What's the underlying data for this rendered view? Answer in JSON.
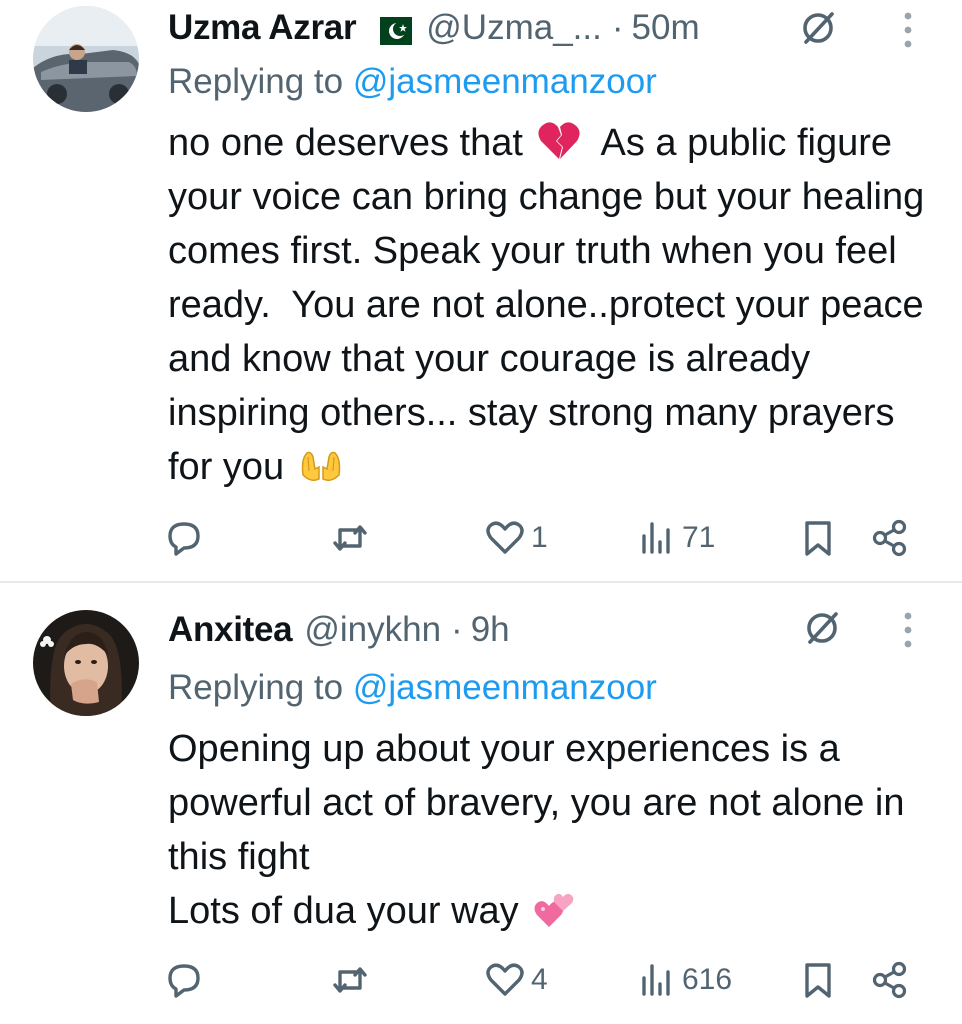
{
  "tweets": [
    {
      "author_name": "Uzma Azrar",
      "author_flag": "pakistan-flag",
      "handle": "@Uzma_...",
      "separator": "·",
      "time": "50m",
      "replying_prefix": "Replying to",
      "replying_to": "@jasmeenmanzoor",
      "text_before_emoji": "no one deserves that",
      "emoji_1": "broken-heart",
      "text_after_emoji": "  As a public figure your voice can bring change but your healing comes first. Speak your truth when you feel ready.  You are not alone..protect your peace and know that your courage is already inspiring others... stay strong many prayers for you",
      "emoji_2": "open-hands",
      "likes": "1",
      "views": "71"
    },
    {
      "author_name": "Anxitea",
      "handle": "@inykhn",
      "separator": "·",
      "time": "9h",
      "replying_prefix": "Replying to",
      "replying_to": "@jasmeenmanzoor",
      "text": "Opening up about your experiences is a powerful act of bravery, you are not alone in this fight\nLots of dua your way",
      "emoji": "two-hearts",
      "likes": "4",
      "views": "616"
    }
  ],
  "colors": {
    "text": "#0f1419",
    "secondary": "#536471",
    "link": "#1d9bf0",
    "divider": "#e6e9ec"
  }
}
